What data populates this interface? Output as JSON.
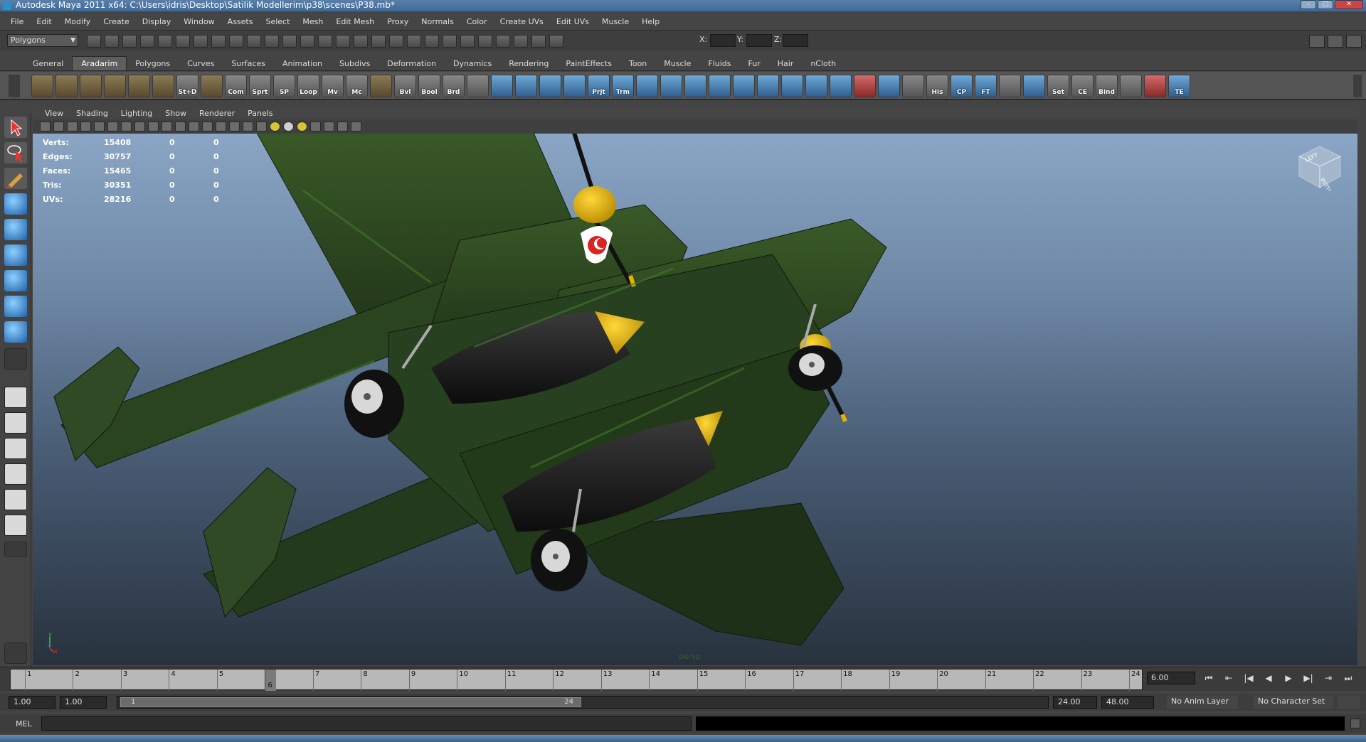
{
  "window": {
    "title": "Autodesk Maya 2011 x64: C:\\Users\\idris\\Desktop\\Satilik Modellerim\\p38\\scenes\\P38.mb*"
  },
  "menu": [
    "File",
    "Edit",
    "Modify",
    "Create",
    "Display",
    "Window",
    "Assets",
    "Select",
    "Mesh",
    "Edit Mesh",
    "Proxy",
    "Normals",
    "Color",
    "Create UVs",
    "Edit UVs",
    "Muscle",
    "Help"
  ],
  "status_line": {
    "mode": "Polygons",
    "x_label": "X:",
    "y_label": "Y:",
    "z_label": "Z:"
  },
  "shelf_tabs": [
    "General",
    "Aradarim",
    "Polygons",
    "Curves",
    "Surfaces",
    "Animation",
    "Subdivs",
    "Deformation",
    "Dynamics",
    "Rendering",
    "PaintEffects",
    "Toon",
    "Muscle",
    "Fluids",
    "Fur",
    "Hair",
    "nCloth"
  ],
  "shelf_labels": [
    "",
    "",
    "",
    "",
    "",
    "",
    "St+D",
    "",
    "Com",
    "Sprt",
    "SP",
    "Loop",
    "Mv",
    "Mc",
    "",
    "Bvl",
    "Bool",
    "Brd",
    "",
    "",
    "",
    "",
    "",
    "Prjt",
    "Trm",
    "",
    "",
    "",
    "",
    "",
    "",
    "",
    "",
    "",
    "",
    "",
    "",
    "His",
    "CP",
    "FT",
    "",
    "",
    "Set",
    "CE",
    "Bind",
    "",
    "",
    "TE"
  ],
  "panel_menu": [
    "View",
    "Shading",
    "Lighting",
    "Show",
    "Renderer",
    "Panels"
  ],
  "hud": {
    "rows": [
      {
        "label": "Verts:",
        "v1": "15408",
        "v2": "0",
        "v3": "0"
      },
      {
        "label": "Edges:",
        "v1": "30757",
        "v2": "0",
        "v3": "0"
      },
      {
        "label": "Faces:",
        "v1": "15465",
        "v2": "0",
        "v3": "0"
      },
      {
        "label": "Tris:",
        "v1": "30351",
        "v2": "0",
        "v3": "0"
      },
      {
        "label": "UVs:",
        "v1": "28216",
        "v2": "0",
        "v3": "0"
      }
    ]
  },
  "viewport": {
    "camera": "persp",
    "viewcube_top": "LEFT",
    "viewcube_bottom": "BOTTOM",
    "axis_y": "y",
    "axis_x": "x"
  },
  "timeline": {
    "ticks": [
      "1",
      "2",
      "3",
      "4",
      "5",
      "6",
      "7",
      "8",
      "9",
      "10",
      "11",
      "12",
      "13",
      "14",
      "15",
      "16",
      "17",
      "18",
      "19",
      "20",
      "21",
      "22",
      "23",
      "24"
    ],
    "current_frame": "6",
    "current_time_field": "6.00",
    "playback": [
      "⏮",
      "⇤",
      "|◀",
      "◀",
      "▶",
      "▶|",
      "⇥",
      "⏭"
    ]
  },
  "range": {
    "start_time": "1.00",
    "playback_start": "1.00",
    "slider_start": "1",
    "slider_end": "24",
    "playback_end": "24.00",
    "end_time": "48.00",
    "anim_layer": "No Anim Layer",
    "character_set": "No Character Set"
  },
  "command_line": {
    "label": "MEL"
  }
}
